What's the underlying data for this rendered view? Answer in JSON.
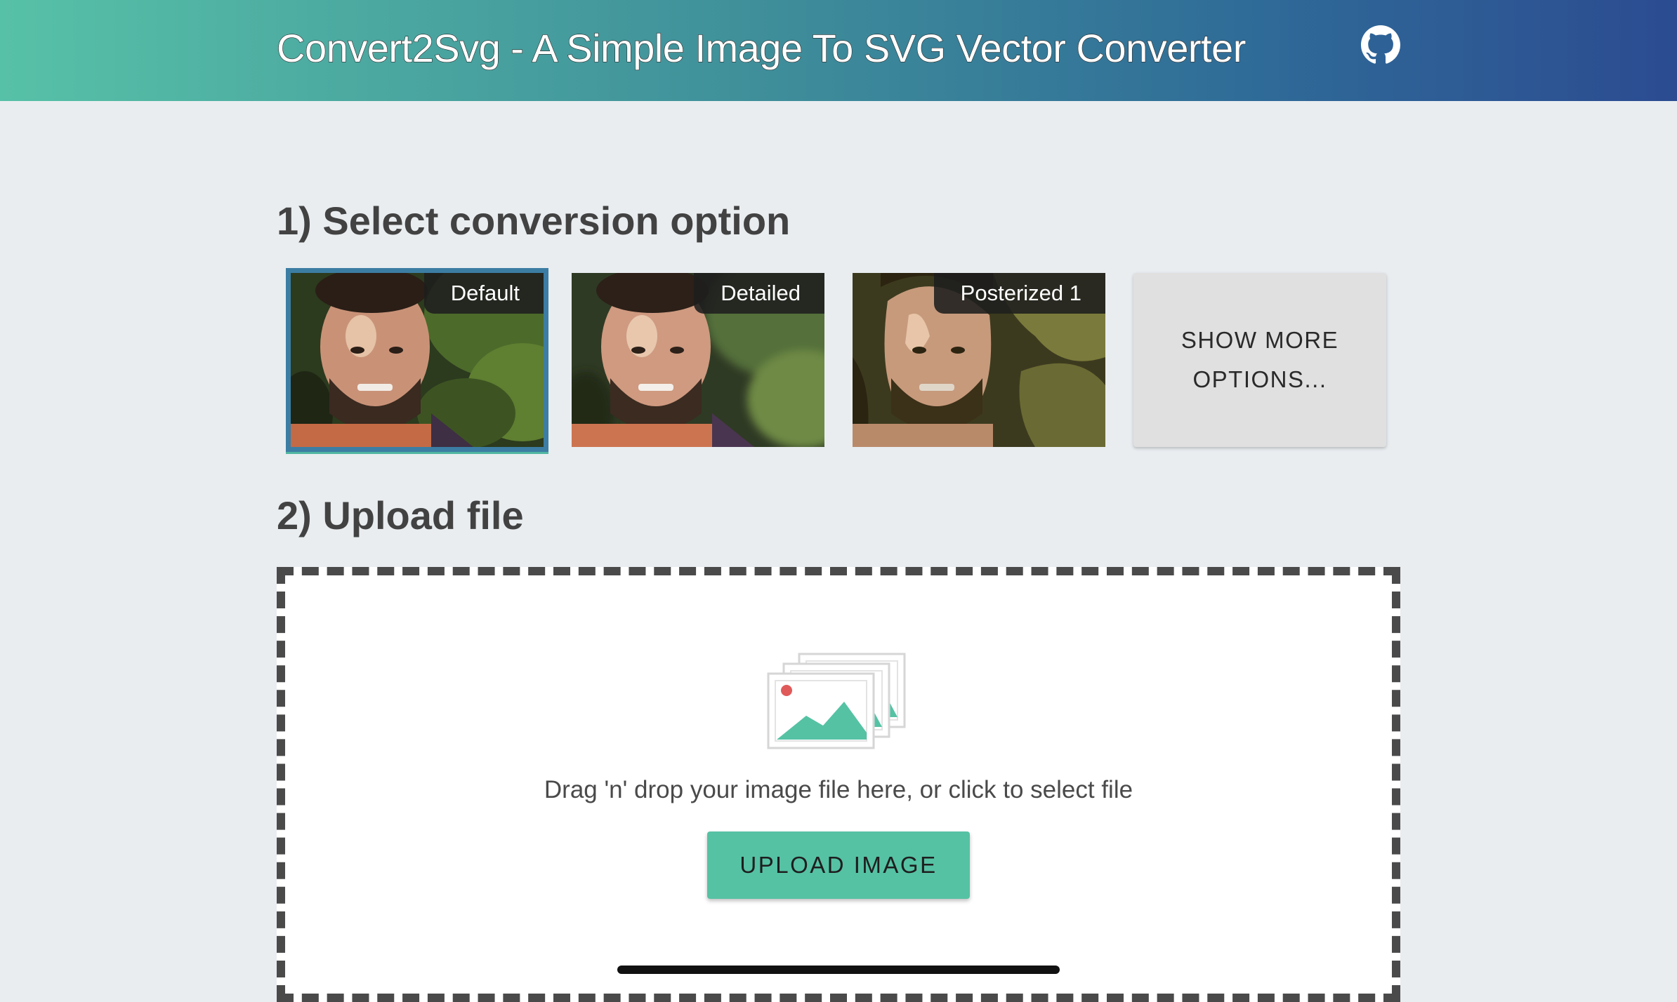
{
  "header": {
    "title": "Convert2Svg - A Simple Image To SVG Vector Converter",
    "github_icon": "github-icon"
  },
  "step1": {
    "heading": "1) Select conversion option",
    "options": [
      {
        "label": "Default",
        "selected": true
      },
      {
        "label": "Detailed",
        "selected": false
      },
      {
        "label": "Posterized 1",
        "selected": false
      }
    ],
    "show_more_label": "SHOW MORE OPTIONS..."
  },
  "step2": {
    "heading": "2) Upload file",
    "illustration_icon": "image-stack-icon",
    "drop_text": "Drag 'n' drop your image file here, or click to select file",
    "upload_button_label": "UPLOAD IMAGE"
  },
  "colors": {
    "header_gradient_start": "#57c1a7",
    "header_gradient_end": "#2c4b91",
    "accent": "#55c2a4",
    "background": "#e9edf0"
  }
}
